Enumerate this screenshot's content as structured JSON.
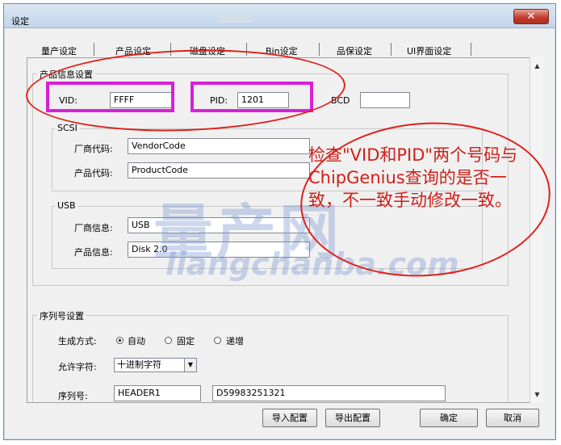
{
  "window": {
    "title": "设定",
    "close_symbol": "✕"
  },
  "tabs": [
    {
      "label": "量产设定"
    },
    {
      "label": "产品设定"
    },
    {
      "label": "磁盘设定"
    },
    {
      "label": "Bin设定"
    },
    {
      "label": "品保设定"
    },
    {
      "label": "UI界面设定"
    }
  ],
  "product_info": {
    "group_label": "产品信息设置",
    "vid_label": "VID:",
    "vid_value": "FFFF",
    "pid_label": "PID:",
    "pid_value": "1201",
    "bcd_label": "BCD",
    "bcd_value": ""
  },
  "scsi": {
    "group_label": "SCSI",
    "vendor_label": "厂商代码:",
    "vendor_value": "VendorCode",
    "product_label": "产品代码:",
    "product_value": "ProductCode"
  },
  "usb": {
    "group_label": "USB",
    "vendor_label": "厂商信息:",
    "vendor_value": "USB",
    "product_label": "产品信息:",
    "product_value": "Disk 2.0"
  },
  "serial": {
    "group_label": "序列号设置",
    "mode_label": "生成方式:",
    "mode_options": [
      "自动",
      "固定",
      "递增"
    ],
    "mode_selected": "自动",
    "charset_label": "允许字符:",
    "charset_value": "十进制字符",
    "serial_label": "序列号:",
    "serial_prefix": "HEADER1",
    "serial_value": "D59983251321"
  },
  "buttons": {
    "import": "导入配置",
    "export": "导出配置",
    "ok": "确定",
    "cancel": "取消"
  },
  "annotation": {
    "text": "检查\"VID和PID\"两个号码与ChipGenius查询的是否一致，不一致手动修改一致。",
    "color": "#d0201a",
    "highlight_color": "#d91fd9"
  },
  "watermark": {
    "title": "量产网",
    "subtitle": "liangchanba.com"
  }
}
